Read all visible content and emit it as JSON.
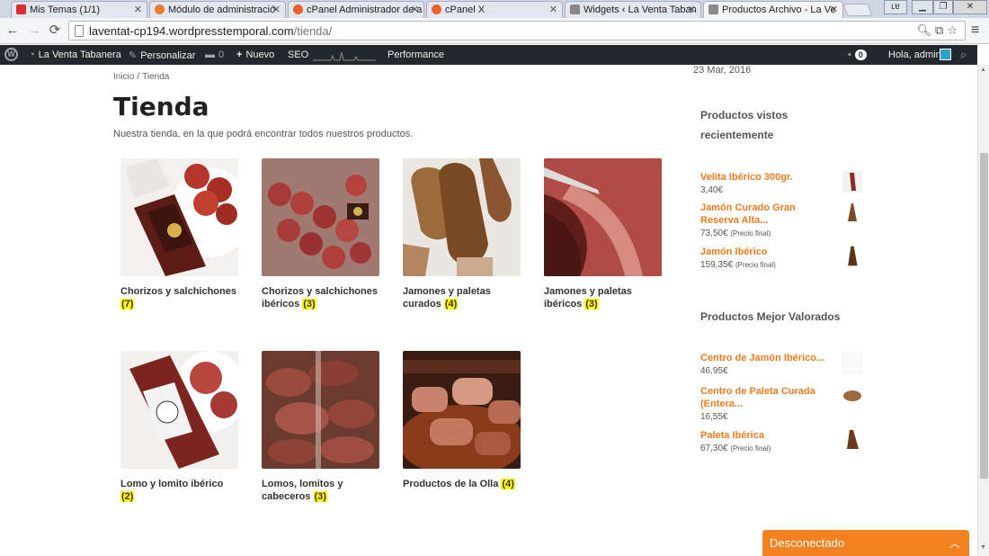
{
  "browser": {
    "tabs": [
      {
        "title": "Mis Temas (1/1)",
        "fav_color": "#d9302e"
      },
      {
        "title": "Módulo de administració",
        "fav_color": "#e87b2e"
      },
      {
        "title": "cPanel Administrador de a",
        "fav_color": "#e8622a"
      },
      {
        "title": "cPanel X",
        "fav_color": "#e8622a"
      },
      {
        "title": "Widgets ‹ La Venta Taban",
        "fav_color": "#888888"
      },
      {
        "title": "Productos Archivo - La Ve",
        "fav_color": "#8a8a8a"
      }
    ],
    "url_host": "laventat-cp194.wordpresstemporal.com",
    "url_path": "/tienda/"
  },
  "adminbar": {
    "site_name": "La Venta Tabanera",
    "customize": "Personalizar",
    "comments_count": "0",
    "new_label": "Nuevo",
    "seo_label": "SEO",
    "performance_label": "Performance",
    "notifications_count": "0",
    "greeting": "Hola, admin"
  },
  "page": {
    "breadcrumb": [
      "Inicio",
      "Tienda"
    ],
    "title": "Tienda",
    "description": "Nuestra tienda, en la que podrá encontrar todos nuestros productos."
  },
  "categories": [
    {
      "name": "Chorizos y salchichones",
      "count": "(7)"
    },
    {
      "name": "Chorizos y salchichones ibéricos",
      "count": "(3)"
    },
    {
      "name": "Jamones y paletas curados",
      "count": "(4)"
    },
    {
      "name": "Jamones y paletas ibéricos",
      "count": "(3)"
    },
    {
      "name": "Lomo y lomito ibérico",
      "count": "(2)"
    },
    {
      "name": "Lomos, lomitos y cabeceros",
      "count": "(3)"
    },
    {
      "name": "Productos de la Olla",
      "count": "(4)"
    }
  ],
  "sidebar": {
    "date": "23 Mar, 2016",
    "recent_title": "Productos vistos recientemente",
    "recent": [
      {
        "name": "Velita Ibérico 300gr.",
        "price": "3,40€",
        "note": ""
      },
      {
        "name": "Jamón Curado Gran Reserva Alta...",
        "price": "73,50€",
        "note": "(Precio final)"
      },
      {
        "name": "Jamón Ibérico",
        "price": "159,35€",
        "note": "(Precio final)"
      }
    ],
    "top_title": "Productos Mejor Valorados",
    "top": [
      {
        "name": "Centro de Jamón Ibérico...",
        "price": "46,95€",
        "note": ""
      },
      {
        "name": "Centro de Paleta Curada (Entera...",
        "price": "16,55€",
        "note": ""
      },
      {
        "name": "Paleta Ibérica",
        "price": "67,30€",
        "note": "(Precio final)"
      }
    ]
  },
  "chat": {
    "label": "Desconectado"
  }
}
